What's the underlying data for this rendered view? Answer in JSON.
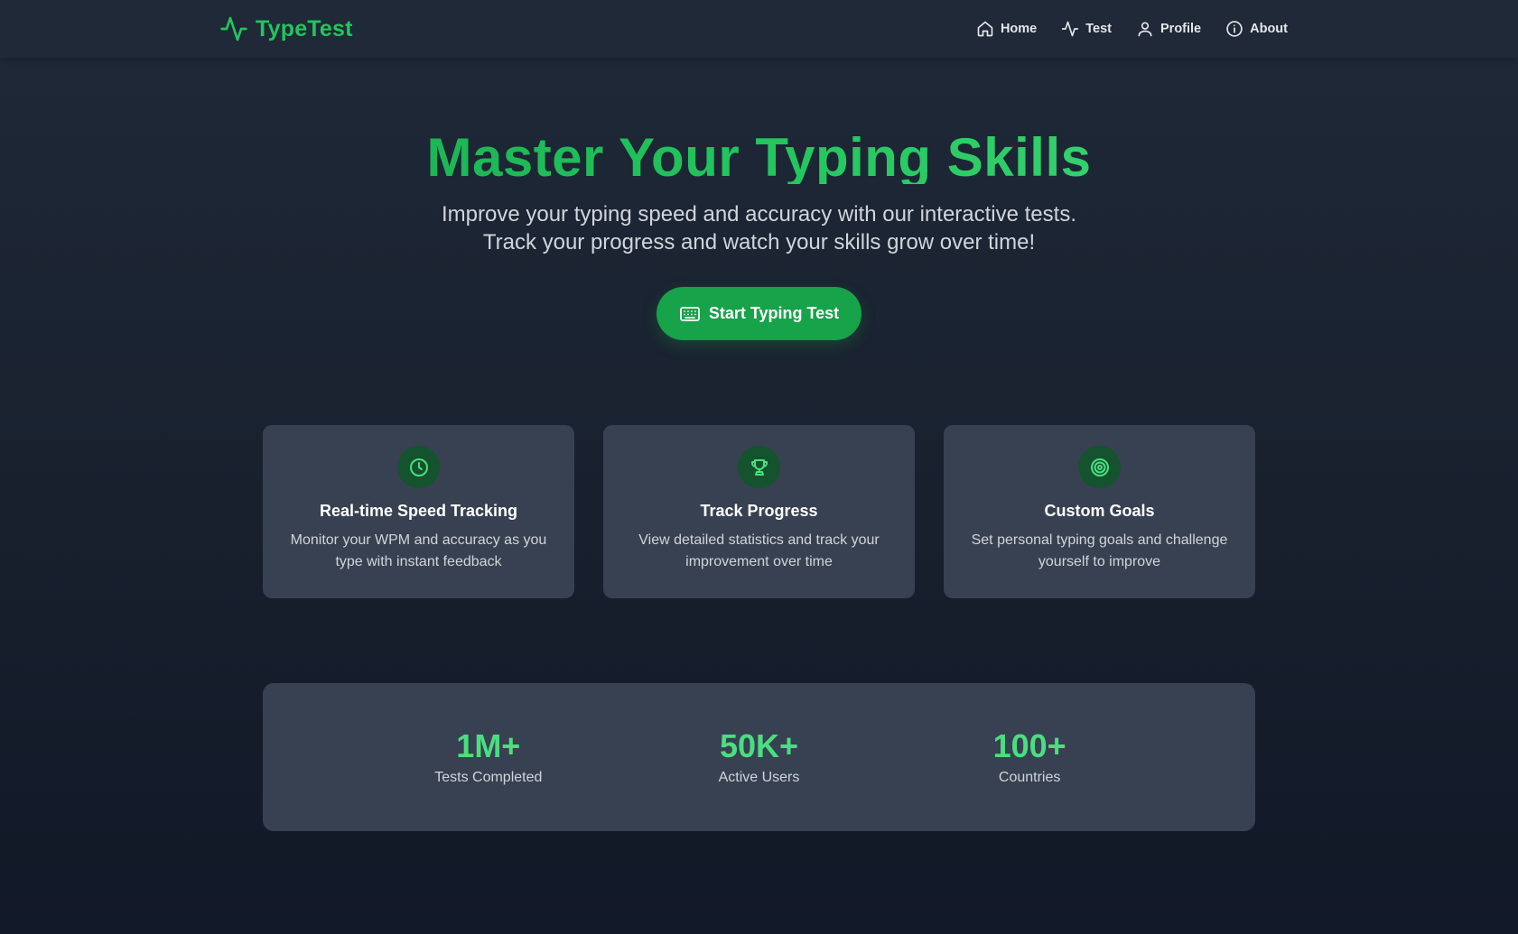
{
  "brand": {
    "name": "TypeTest",
    "icon": "activity-icon",
    "color": "#22c55e"
  },
  "nav": {
    "items": [
      {
        "label": "Home",
        "icon": "home-icon"
      },
      {
        "label": "Test",
        "icon": "activity-icon"
      },
      {
        "label": "Profile",
        "icon": "user-icon"
      },
      {
        "label": "About",
        "icon": "info-icon"
      }
    ]
  },
  "hero": {
    "title": "Master Your Typing Skills",
    "subtitle": "Improve your typing speed and accuracy with our interactive tests. Track your progress and watch your skills grow over time!",
    "cta_label": "Start Typing Test",
    "cta_icon": "keyboard-icon"
  },
  "features": [
    {
      "title": "Real-time Speed Tracking",
      "description": "Monitor your WPM and accuracy as you type with instant feedback",
      "icon": "clock-icon"
    },
    {
      "title": "Track Progress",
      "description": "View detailed statistics and track your improvement over time",
      "icon": "trophy-icon"
    },
    {
      "title": "Custom Goals",
      "description": "Set personal typing goals and challenge yourself to improve",
      "icon": "target-icon"
    }
  ],
  "stats": [
    {
      "value": "1M+",
      "label": "Tests Completed"
    },
    {
      "value": "50K+",
      "label": "Active Users"
    },
    {
      "value": "100+",
      "label": "Countries"
    }
  ],
  "colors": {
    "accent": "#22c55e",
    "accent_dark": "#16a34a",
    "background": "#111827",
    "card": "#374151",
    "nav": "#1f2937"
  }
}
